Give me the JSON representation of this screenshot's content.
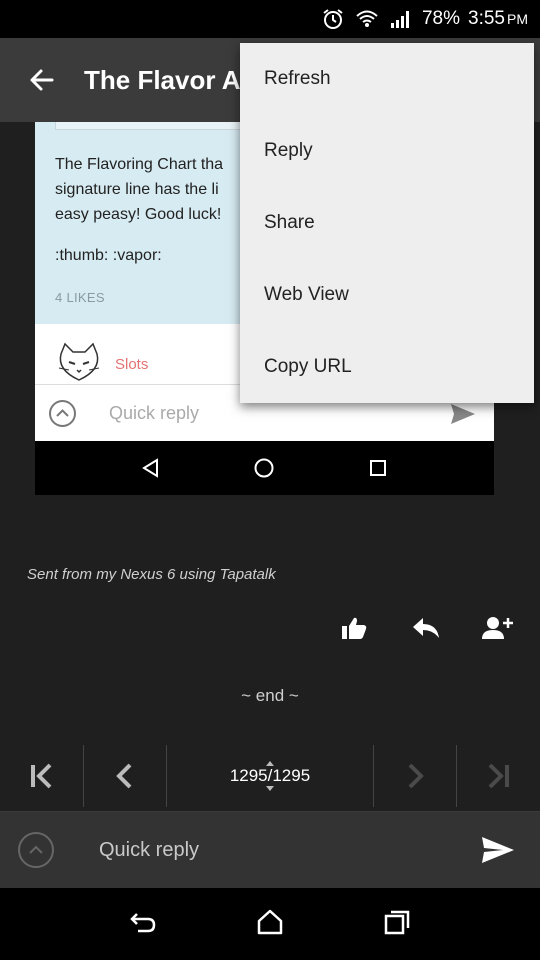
{
  "status": {
    "battery": "78%",
    "time": "3:55",
    "ampm": "PM"
  },
  "appbar": {
    "title": "The Flavor A"
  },
  "screenshot": {
    "post_text": "The Flavoring Chart tha\nsignature line has the li\neasy peasy! Good luck!",
    "emotes": ":thumb: :vapor:",
    "likes": "4 LIKES",
    "author": "Slots",
    "quick_reply_placeholder": "Quick reply"
  },
  "menu": {
    "items": [
      {
        "label": "Refresh"
      },
      {
        "label": "Reply"
      },
      {
        "label": "Share"
      },
      {
        "label": "Web View"
      },
      {
        "label": "Copy URL"
      }
    ]
  },
  "post": {
    "signature": "Sent from my Nexus 6 using Tapatalk"
  },
  "end_label": "~ end ~",
  "pager": {
    "page": "1295/1295"
  },
  "quickreply": {
    "placeholder": "Quick reply"
  },
  "colors": {
    "appbar": "#3b3b3b",
    "menu": "#eeeeee",
    "quote_bg": "#d7ebf2",
    "author_name": "#e57373"
  }
}
